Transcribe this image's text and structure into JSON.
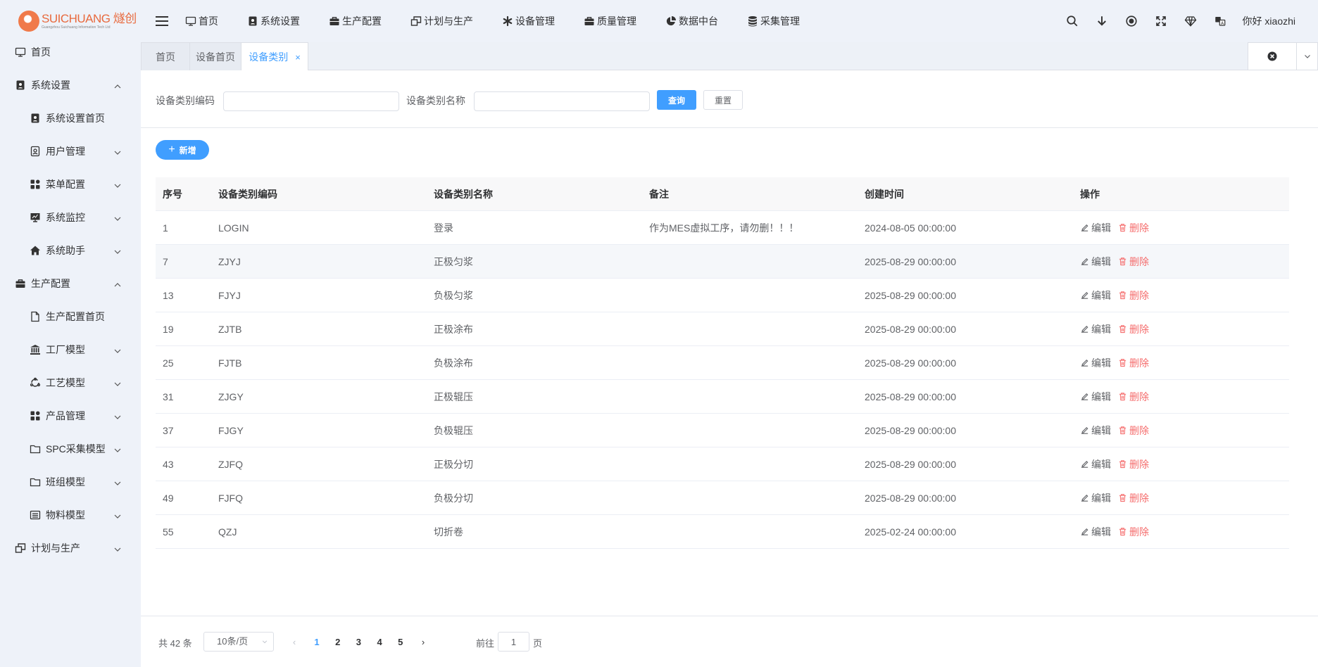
{
  "brand": {
    "name": "SUICHUANG 燧创",
    "subtitle": "Guangzhou Suichuang Information Tech Ltd"
  },
  "topnav": [
    {
      "label": "首页",
      "icon": "monitor-icon"
    },
    {
      "label": "系统设置",
      "icon": "user-badge-icon"
    },
    {
      "label": "生产配置",
      "icon": "briefcase-icon"
    },
    {
      "label": "计划与生产",
      "icon": "windows-icon"
    },
    {
      "label": "设备管理",
      "icon": "asterisk-icon"
    },
    {
      "label": "质量管理",
      "icon": "briefcase-icon"
    },
    {
      "label": "数据中台",
      "icon": "pie-chart-icon"
    },
    {
      "label": "采集管理",
      "icon": "database-icon"
    }
  ],
  "header": {
    "greeting": "你好 xiaozhi"
  },
  "sidebar": {
    "items": [
      {
        "label": "首页",
        "level": 1,
        "icon": "monitor-icon",
        "arrow": "none"
      },
      {
        "label": "系统设置",
        "level": 1,
        "icon": "user-badge-icon",
        "arrow": "up"
      },
      {
        "label": "系统设置首页",
        "level": 2,
        "icon": "user-badge-icon",
        "arrow": "none"
      },
      {
        "label": "用户管理",
        "level": 2,
        "icon": "user-card-icon",
        "arrow": "down"
      },
      {
        "label": "菜单配置",
        "level": 2,
        "icon": "grid-icon",
        "arrow": "down"
      },
      {
        "label": "系统监控",
        "level": 2,
        "icon": "screen-icon",
        "arrow": "down"
      },
      {
        "label": "系统助手",
        "level": 2,
        "icon": "home-icon",
        "arrow": "down"
      },
      {
        "label": "生产配置",
        "level": 1,
        "icon": "briefcase-icon",
        "arrow": "up"
      },
      {
        "label": "生产配置首页",
        "level": 2,
        "icon": "document-icon",
        "arrow": "none"
      },
      {
        "label": "工厂模型",
        "level": 2,
        "icon": "bank-icon",
        "arrow": "down"
      },
      {
        "label": "工艺模型",
        "level": 2,
        "icon": "cycle-icon",
        "arrow": "down"
      },
      {
        "label": "产品管理",
        "level": 2,
        "icon": "grid-icon",
        "arrow": "down"
      },
      {
        "label": "SPC采集模型",
        "level": 2,
        "icon": "folder-icon",
        "arrow": "down"
      },
      {
        "label": "班组模型",
        "level": 2,
        "icon": "folder-icon",
        "arrow": "down"
      },
      {
        "label": "物料模型",
        "level": 2,
        "icon": "list-icon",
        "arrow": "down"
      },
      {
        "label": "计划与生产",
        "level": 1,
        "icon": "windows-icon",
        "arrow": "down"
      }
    ]
  },
  "tabs": [
    {
      "label": "首页",
      "active": false
    },
    {
      "label": "设备首页",
      "active": false
    },
    {
      "label": "设备类别",
      "active": true,
      "close": "×"
    }
  ],
  "search": {
    "code_label": "设备类别编码",
    "code_value": "",
    "name_label": "设备类别名称",
    "name_value": "",
    "query_label": "查询",
    "reset_label": "重置"
  },
  "toolbar": {
    "add_label": "新增",
    "add_symbol": "+"
  },
  "table": {
    "columns": [
      "序号",
      "设备类别编码",
      "设备类别名称",
      "备注",
      "创建时间",
      "操作"
    ],
    "edit_label": "编辑",
    "delete_label": "删除",
    "rows": [
      {
        "id": "1",
        "code": "LOGIN",
        "name": "登录",
        "remark": "作为MES虚拟工序，请勿删！！！",
        "created": "2024-08-05 00:00:00"
      },
      {
        "id": "7",
        "code": "ZJYJ",
        "name": "正极匀浆",
        "remark": "",
        "created": "2025-08-29 00:00:00"
      },
      {
        "id": "13",
        "code": "FJYJ",
        "name": "负极匀浆",
        "remark": "",
        "created": "2025-08-29 00:00:00"
      },
      {
        "id": "19",
        "code": "ZJTB",
        "name": "正极涂布",
        "remark": "",
        "created": "2025-08-29 00:00:00"
      },
      {
        "id": "25",
        "code": "FJTB",
        "name": "负极涂布",
        "remark": "",
        "created": "2025-08-29 00:00:00"
      },
      {
        "id": "31",
        "code": "ZJGY",
        "name": "正极辊压",
        "remark": "",
        "created": "2025-08-29 00:00:00"
      },
      {
        "id": "37",
        "code": "FJGY",
        "name": "负极辊压",
        "remark": "",
        "created": "2025-08-29 00:00:00"
      },
      {
        "id": "43",
        "code": "ZJFQ",
        "name": "正极分切",
        "remark": "",
        "created": "2025-08-29 00:00:00"
      },
      {
        "id": "49",
        "code": "FJFQ",
        "name": "负极分切",
        "remark": "",
        "created": "2025-08-29 00:00:00"
      },
      {
        "id": "55",
        "code": "QZJ",
        "name": "切折卷",
        "remark": "",
        "created": "2025-02-24 00:00:00"
      }
    ]
  },
  "pagination": {
    "total_label": "共 42 条",
    "page_size": "10条/页",
    "pages": [
      "1",
      "2",
      "3",
      "4",
      "5"
    ],
    "current": "1",
    "goto_prefix": "前往",
    "goto_value": "1",
    "goto_suffix": "页",
    "prev": "‹",
    "next": "›"
  },
  "colors": {
    "primary": "#409eff",
    "danger": "#f56c6c",
    "brand": "#e86a3e"
  }
}
